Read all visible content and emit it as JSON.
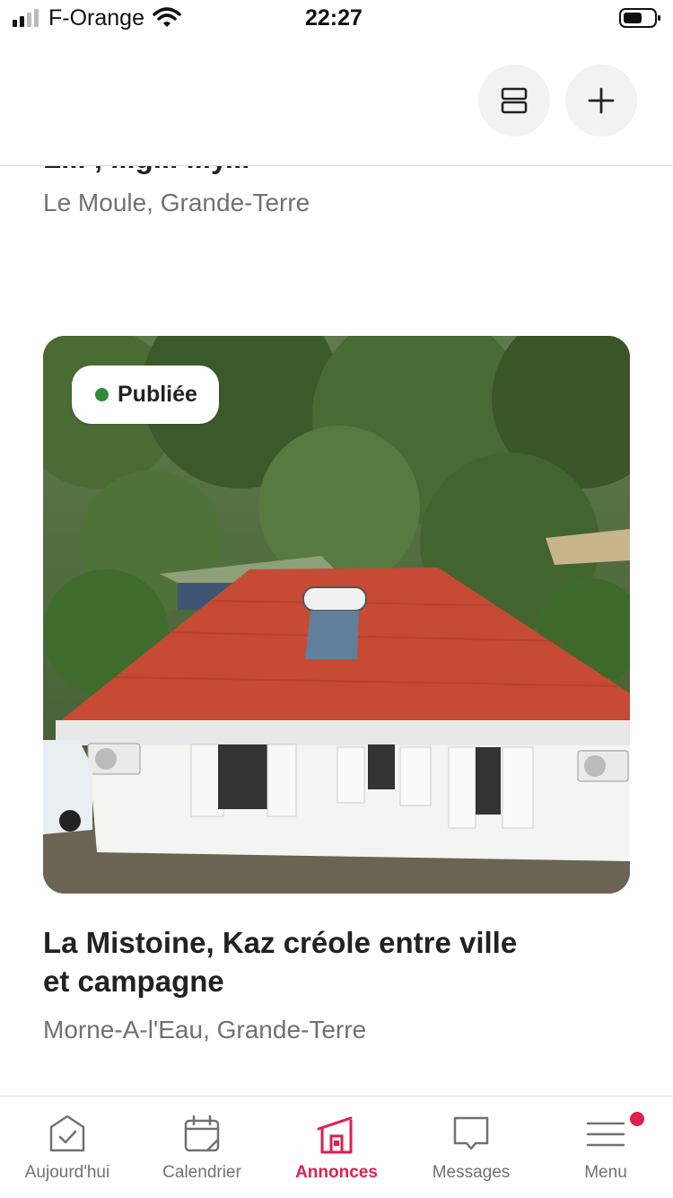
{
  "status_bar": {
    "carrier": "F-Orange",
    "time": "22:27"
  },
  "header": {
    "icons": [
      "view-toggle-icon",
      "plus-icon"
    ]
  },
  "listings": {
    "previous": {
      "title_cut": "L... , ...g... ...y...",
      "location": "Le Moule, Grande-Terre"
    },
    "current": {
      "status": "Publiée",
      "status_color": "#2e8b3a",
      "title": "La Mistoine, Kaz créole entre ville et campagne",
      "location": "Morne-A-l'Eau, Grande-Terre"
    }
  },
  "tabbar": {
    "tabs": [
      {
        "label": "Aujourd'hui",
        "icon": "today-check-icon",
        "active": false
      },
      {
        "label": "Calendrier",
        "icon": "calendar-icon",
        "active": false
      },
      {
        "label": "Annonces",
        "icon": "home-listings-icon",
        "active": true
      },
      {
        "label": "Messages",
        "icon": "message-icon",
        "active": false
      },
      {
        "label": "Menu",
        "icon": "menu-icon",
        "active": false,
        "has_notification": true
      }
    ],
    "active_color": "#e01e4f"
  }
}
